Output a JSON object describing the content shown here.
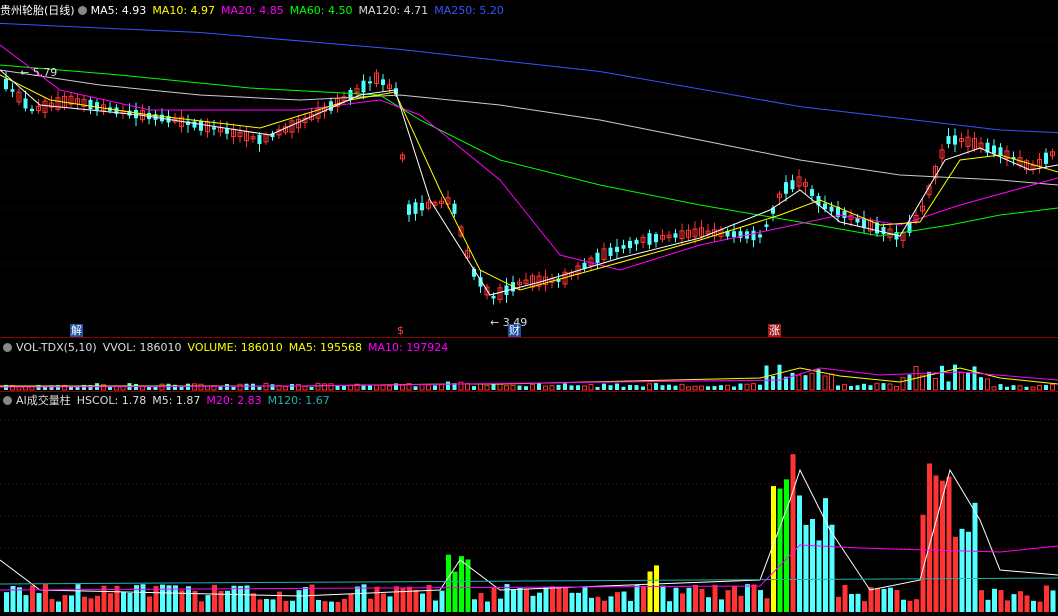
{
  "main_panel": {
    "title": "贵州轮胎(日线)",
    "ma": [
      {
        "label": "MA5: 4.93",
        "color": "#ffffff"
      },
      {
        "label": "MA10: 4.97",
        "color": "#ffff00"
      },
      {
        "label": "MA20: 4.85",
        "color": "#ff00ff"
      },
      {
        "label": "MA60: 4.50",
        "color": "#00ff00"
      },
      {
        "label": "MA120: 4.71",
        "color": "#dddddd"
      },
      {
        "label": "MA250: 5.20",
        "color": "#3355ff"
      }
    ],
    "high_label": "5.79",
    "low_label": "3.49",
    "markers": {
      "left": "解",
      "mid": "$",
      "low": "财",
      "right": "涨"
    }
  },
  "vol_panel": {
    "title": "VOL-TDX(5,10)",
    "items": [
      {
        "label": "VVOL: 186010",
        "color": "#dddddd"
      },
      {
        "label": "VOLUME: 186010",
        "color": "#ffff00"
      },
      {
        "label": "MA5: 195568",
        "color": "#ffff00"
      },
      {
        "label": "MA10: 197924",
        "color": "#ff00ff"
      }
    ]
  },
  "ai_panel": {
    "title": "AI成交量柱",
    "items": [
      {
        "label": "HSCOL: 1.78",
        "color": "#dddddd"
      },
      {
        "label": "M5: 1.87",
        "color": "#dddddd"
      },
      {
        "label": "M20: 2.83",
        "color": "#ff00ff"
      },
      {
        "label": "M120: 1.67",
        "color": "#20b2aa"
      }
    ]
  },
  "colors": {
    "up": "#ff3333",
    "down": "#54ffff",
    "ma250": "#3355ff",
    "grid": "#7a0000"
  }
}
